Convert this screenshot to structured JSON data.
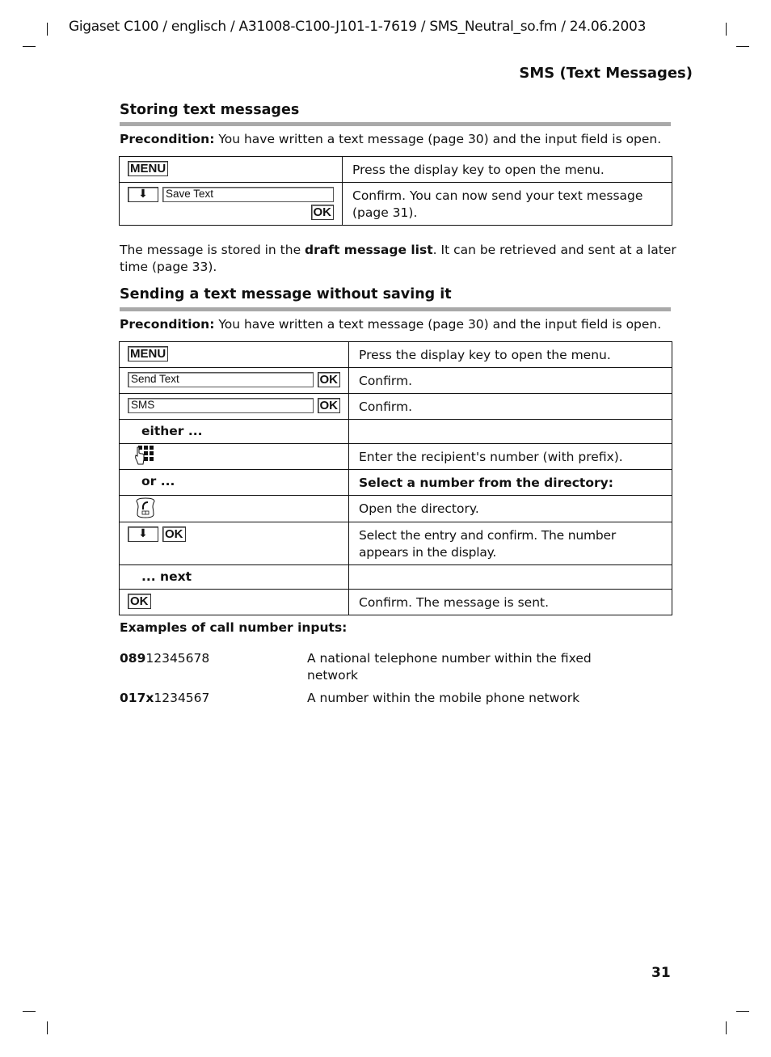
{
  "header": {
    "running_line": "Gigaset C100 / englisch / A31008-C100-J101-1-7619 / SMS_Neutral_so.fm / 24.06.2003",
    "section": "SMS (Text Messages)"
  },
  "storing": {
    "title": "Storing text messages",
    "precondition_label": "Precondition:",
    "precondition_text": " You have written a text message (page 30) and the input field is open.",
    "steps": [
      {
        "key": "MENU",
        "desc": "Press the display key to open the menu."
      },
      {
        "arrow_icon": "down-arrow-key",
        "field": "Save Text",
        "key": "OK",
        "desc": "Confirm. You can now send your text message (page 31)."
      }
    ],
    "note_pre": "The message is stored in the ",
    "note_bold": "draft message list",
    "note_post": ". It can be retrieved and sent at a later time (page 33)."
  },
  "sending": {
    "title": "Sending a text message without saving it",
    "precondition_label": "Precondition:",
    "precondition_text": " You have written a text message (page 30) and the input field is open.",
    "steps": [
      {
        "key": "MENU",
        "desc": "Press the display key to open the menu."
      },
      {
        "field": "Send Text",
        "key": "OK",
        "desc": "Confirm."
      },
      {
        "field": "SMS",
        "key": "OK",
        "desc": "Confirm."
      },
      {
        "label": "either ...",
        "desc": ""
      },
      {
        "icon": "keypad-icon",
        "desc": "Enter the recipient's number (with prefix)."
      },
      {
        "label": "or ...",
        "desc": "Select a number from the directory:"
      },
      {
        "icon": "directory-key-icon",
        "desc": "Open the directory."
      },
      {
        "arrow_icon": "down-arrow-key",
        "key": "OK",
        "desc": "Select the entry and confirm. The number appears in the display."
      },
      {
        "label": "... next",
        "desc": ""
      },
      {
        "key": "OK",
        "desc": "Confirm. The message is sent."
      }
    ]
  },
  "examples": {
    "title": "Examples of call number inputs:",
    "items": [
      {
        "bold": "089",
        "rest": "12345678",
        "desc": "A national telephone number within the fixed network"
      },
      {
        "bold": "017x",
        "rest": "1234567",
        "desc": "A number within the mobile phone network"
      }
    ]
  },
  "page_number": "31"
}
